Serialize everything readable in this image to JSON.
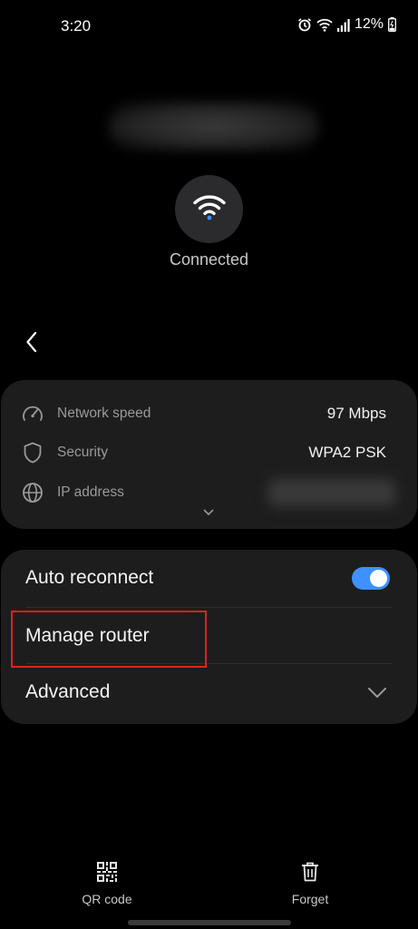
{
  "status_bar": {
    "time": "3:20",
    "battery": "12%",
    "icons": [
      "alarm-icon",
      "wifi-icon",
      "signal-icon",
      "battery-icon"
    ]
  },
  "network": {
    "name_visible": false,
    "status": "Connected",
    "icon": "wifi-icon"
  },
  "info": {
    "rows": [
      {
        "icon": "speedometer-icon",
        "label": "Network speed",
        "value": "97 Mbps"
      },
      {
        "icon": "shield-icon",
        "label": "Security",
        "value": "WPA2 PSK"
      },
      {
        "icon": "globe-icon",
        "label": "IP address",
        "value": ""
      }
    ]
  },
  "settings": {
    "auto_reconnect": {
      "label": "Auto reconnect",
      "enabled": true
    },
    "manage_router": {
      "label": "Manage router"
    },
    "advanced": {
      "label": "Advanced"
    }
  },
  "bottom_actions": {
    "qr_code": "QR code",
    "forget": "Forget"
  },
  "colors": {
    "background": "#000000",
    "card": "#1d1d1d",
    "accent": "#3e91ff",
    "highlight": "#e02020"
  }
}
